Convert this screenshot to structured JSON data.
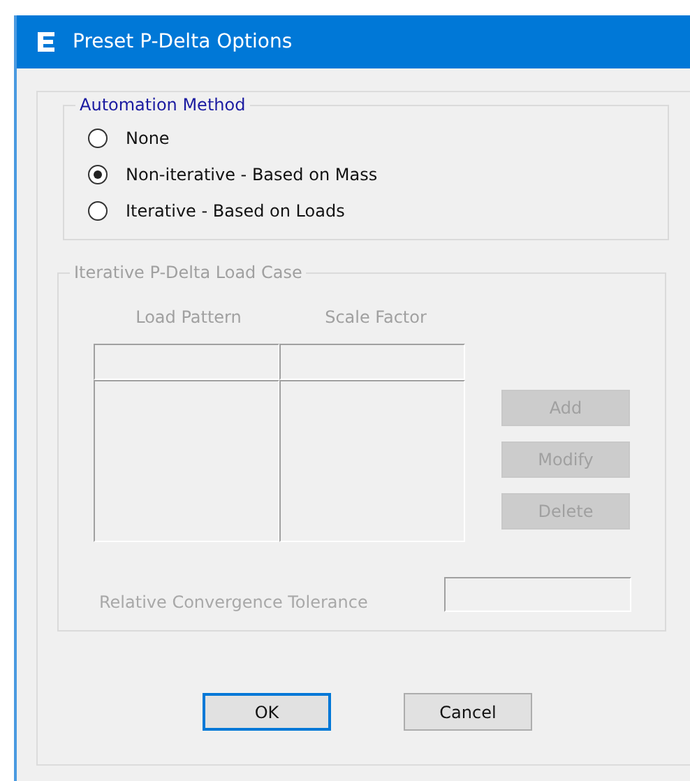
{
  "window": {
    "title": "Preset P-Delta Options"
  },
  "automation_method": {
    "title": "Automation Method",
    "options": [
      {
        "label": "None",
        "selected": false
      },
      {
        "label": "Non-iterative - Based on Mass",
        "selected": true
      },
      {
        "label": "Iterative - Based on Loads",
        "selected": false
      }
    ]
  },
  "load_case": {
    "title": "Iterative P-Delta Load Case",
    "disabled": true,
    "columns": [
      "Load Pattern",
      "Scale Factor"
    ],
    "buttons": [
      "Add",
      "Modify",
      "Delete"
    ],
    "tolerance": {
      "label": "Relative Convergence Tolerance"
    }
  },
  "buttons": [
    {
      "label": "OK",
      "focused": true
    },
    {
      "label": "Cancel",
      "focused": false
    }
  ]
}
